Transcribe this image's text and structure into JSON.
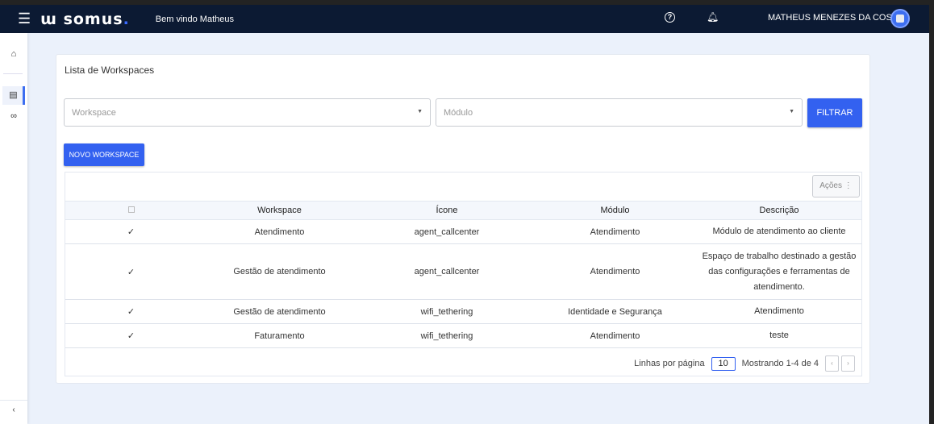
{
  "header": {
    "brand": "somus",
    "welcome": "Bem vindo Matheus",
    "user": "MATHEUS MENEZES DA COSTA"
  },
  "page": {
    "title": "Lista de Workspaces",
    "workspace_placeholder": "Workspace",
    "modulo_placeholder": "Módulo",
    "filter_label": "FILTRAR",
    "new_label": "NOVO WORKSPACE",
    "actions_label": "Ações"
  },
  "table": {
    "headers": [
      "Workspace",
      "Ícone",
      "Módulo",
      "Descrição"
    ],
    "rows": [
      {
        "workspace": "Atendimento",
        "icone": "agent_callcenter",
        "modulo": "Atendimento",
        "descricao": "Módulo de atendimento ao cliente"
      },
      {
        "workspace": "Gestão de atendimento",
        "icone": "agent_callcenter",
        "modulo": "Atendimento",
        "descricao": "Espaço de trabalho destinado a gestão das configurações e ferramentas de atendimento."
      },
      {
        "workspace": "Gestão de atendimento",
        "icone": "wifi_tethering",
        "modulo": "Identidade e Segurança",
        "descricao": "Atendimento"
      },
      {
        "workspace": "Faturamento",
        "icone": "wifi_tethering",
        "modulo": "Atendimento",
        "descricao": "teste"
      }
    ]
  },
  "pagination": {
    "rows_label": "Linhas por página",
    "rows_value": "10",
    "showing": "Mostrando 1-4 de 4"
  }
}
